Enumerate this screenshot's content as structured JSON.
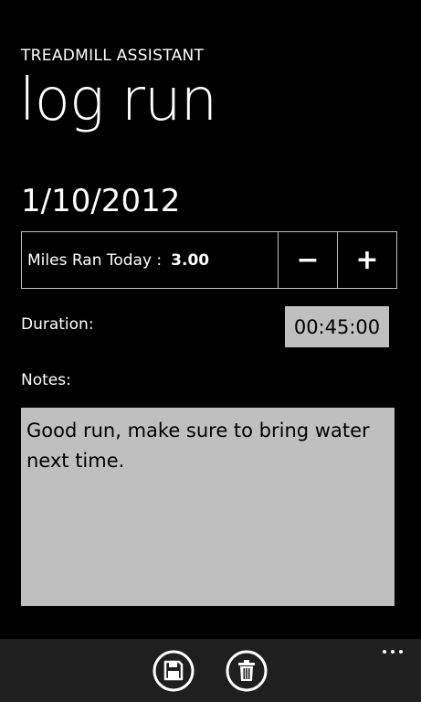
{
  "app_title": "TREADMILL ASSISTANT",
  "page_title": "log run",
  "date": "1/10/2012",
  "miles": {
    "label": "Miles Ran Today :",
    "value": "3.00",
    "decrement_label": "−",
    "increment_label": "+"
  },
  "duration": {
    "label": "Duration:",
    "value": "00:45:00"
  },
  "notes": {
    "label": "Notes:",
    "value": "Good run, make sure to bring water next time."
  },
  "app_bar": {
    "buttons": [
      {
        "icon": "save-icon"
      },
      {
        "icon": "delete-icon"
      }
    ],
    "more_icon": "ellipsis-icon"
  },
  "colors": {
    "background": "#000000",
    "field_background": "#bfbfbf",
    "app_bar": "#1f1f1f",
    "text": "#ffffff"
  }
}
